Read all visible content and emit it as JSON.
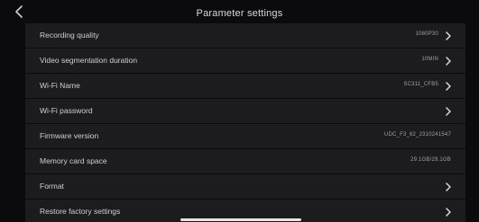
{
  "header": {
    "title": "Parameter settings",
    "back_icon": "chevron-left-icon"
  },
  "settings": [
    {
      "id": "recording-quality",
      "label": "Recording quality",
      "value": "1080P30",
      "chevron": true
    },
    {
      "id": "video-segmentation-duration",
      "label": "Video segmentation duration",
      "value": "10MIN",
      "chevron": true
    },
    {
      "id": "wifi-name",
      "label": "Wi-Fi Name",
      "value": "SC311_CFB5",
      "chevron": true
    },
    {
      "id": "wifi-password",
      "label": "Wi-Fi password",
      "value": "",
      "chevron": true
    },
    {
      "id": "firmware-version",
      "label": "Firmware version",
      "value": "UDC_F3_62_2310241547",
      "chevron": false
    },
    {
      "id": "memory-card-space",
      "label": "Memory card space",
      "value": "29.1GB/29.1GB",
      "chevron": false
    },
    {
      "id": "format",
      "label": "Format",
      "value": "",
      "chevron": true
    },
    {
      "id": "restore-factory-settings",
      "label": "Restore factory settings",
      "value": "",
      "chevron": true
    }
  ],
  "colors": {
    "background": "#0b0b0d",
    "row_background": "#1c1c1f",
    "text": "#cfcfd2",
    "value_text": "#a0a0a4"
  }
}
